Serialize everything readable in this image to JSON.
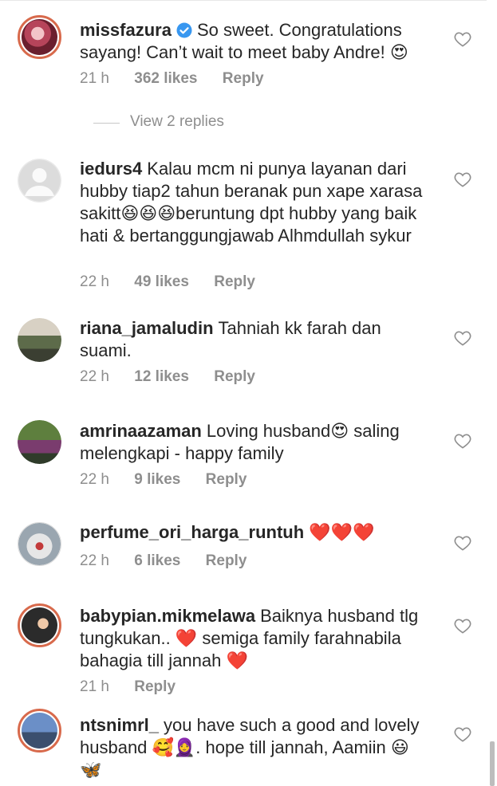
{
  "comments": [
    {
      "username": "missfazura",
      "verified": true,
      "text": "So sweet. Congratulations sayang! Can’t wait to meet baby Andre! 😍",
      "time": "21 h",
      "likes": "362 likes",
      "reply": "Reply"
    },
    {
      "username": "iedurs4",
      "text": "Kalau mcm ni punya layanan dari hubby tiap2 tahun beranak pun xape xarasa sakitt😆😆😆beruntung dpt hubby yang baik hati & bertanggungjawab Alhmdullah sykur",
      "time": "22 h",
      "likes": "49 likes",
      "reply": "Reply"
    },
    {
      "username": "riana_jamaludin",
      "text": "Tahniah kk farah dan suami.",
      "time": "22 h",
      "likes": "12 likes",
      "reply": "Reply"
    },
    {
      "username": "amrinaazaman",
      "text": "Loving husband😍 saling melengkapi - happy family",
      "time": "22 h",
      "likes": "9 likes",
      "reply": "Reply"
    },
    {
      "username": "perfume_ori_harga_runtuh",
      "text": "❤️❤️❤️",
      "time": "22 h",
      "likes": "6 likes",
      "reply": "Reply"
    },
    {
      "username": "babypian.mikmelawa",
      "text": "Baiknya husband tlg tungkukan.. ❤️ semiga family farahnabila bahagia till jannah ❤️",
      "time": "21 h",
      "reply": "Reply"
    },
    {
      "username": "ntsnimrl_",
      "text": "you have such a good and lovely husband 🥰🧕. hope till jannah, Aamiin 😃 🦋"
    }
  ],
  "view_replies": "View 2 replies",
  "icons": {
    "like": "heart-outline-icon",
    "verified": "verified-badge-icon"
  },
  "colors": {
    "text": "#262626",
    "secondary": "#8e8e8e",
    "verified": "#3897f0",
    "story_ring": "#d86a4c"
  }
}
